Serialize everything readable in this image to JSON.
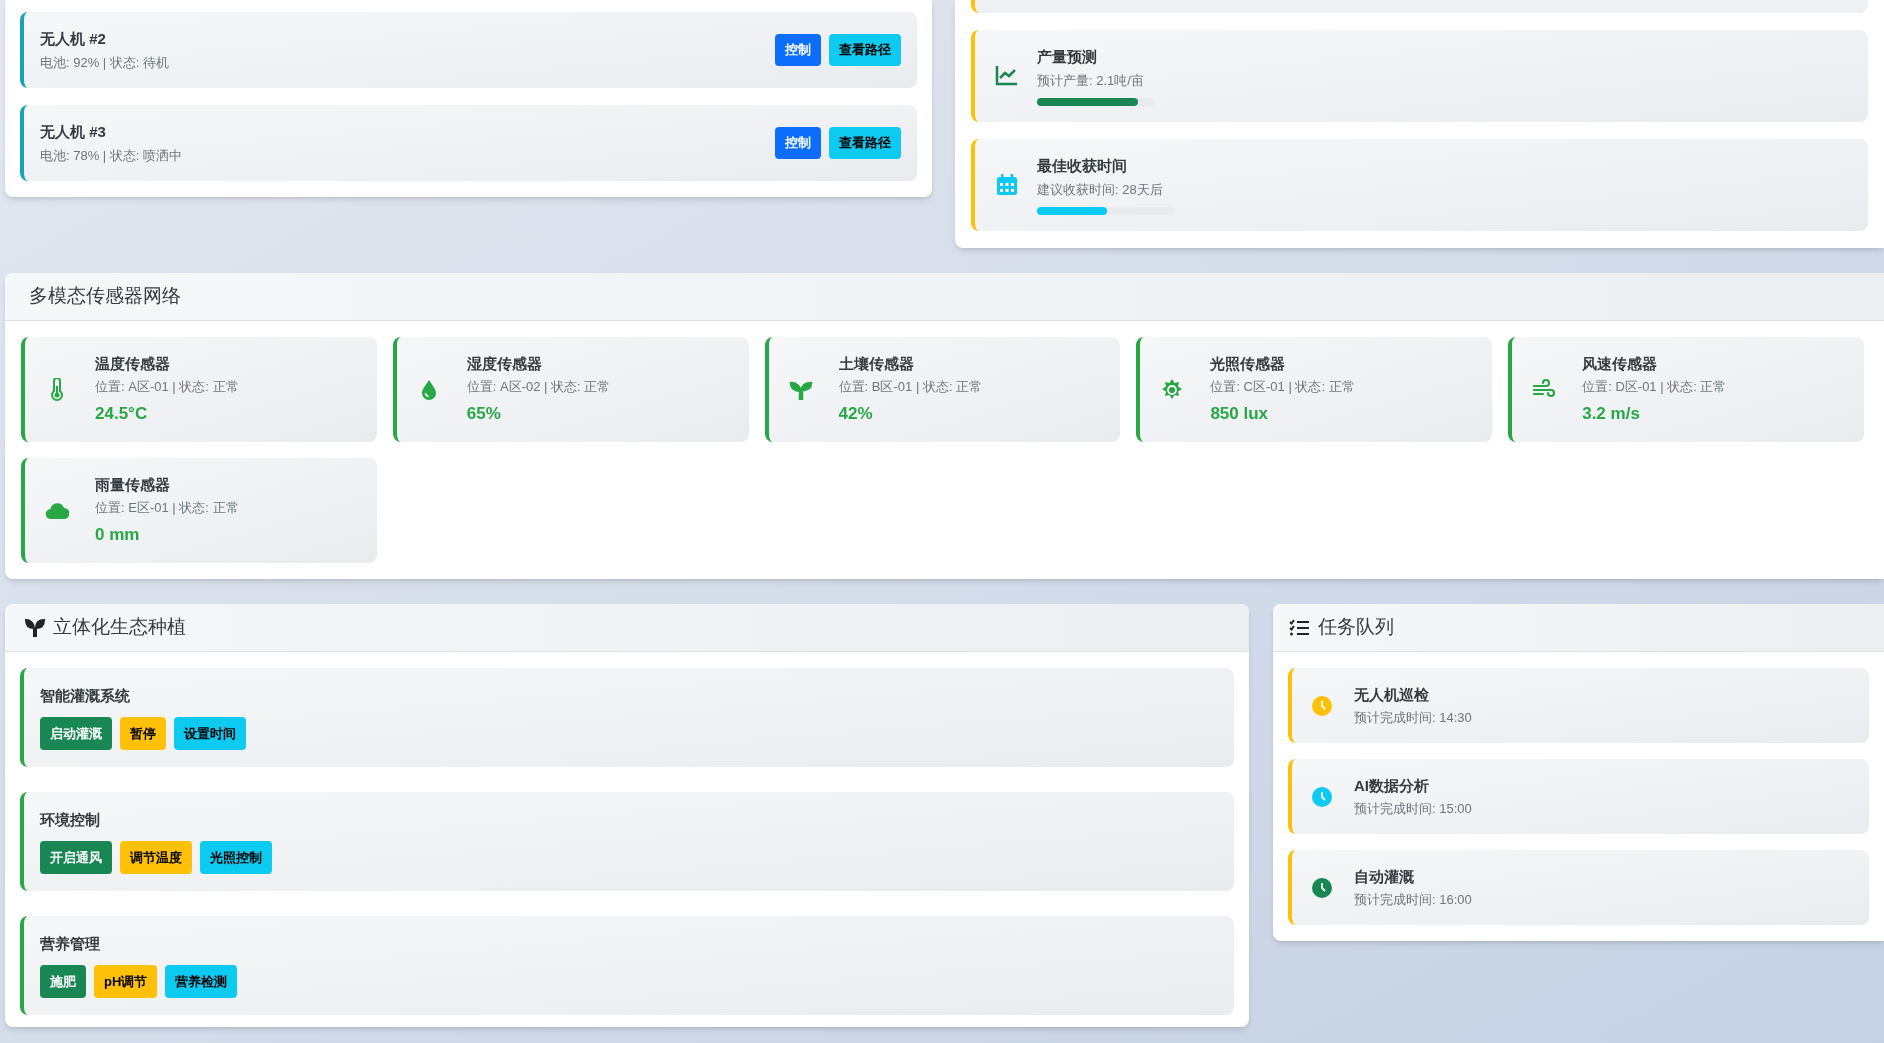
{
  "drones": [
    {
      "name": "无人机 #2",
      "info": "电池: 92% | 状态: 待机",
      "buttons": [
        {
          "label": "控制",
          "kind": "primary"
        },
        {
          "label": "查看路径",
          "kind": "info"
        }
      ]
    },
    {
      "name": "无人机 #3",
      "info": "电池: 78% | 状态: 喷洒中",
      "buttons": [
        {
          "label": "控制",
          "kind": "primary"
        },
        {
          "label": "查看路径",
          "kind": "info"
        }
      ]
    }
  ],
  "predictions": [
    {
      "kind": "yield",
      "title": "产量预测",
      "text": "预计产量: 2.1吨/亩",
      "level": 0.86,
      "color": "#198754"
    },
    {
      "kind": "harvest",
      "title": "最佳收获时间",
      "text": "建议收获时间: 28天后",
      "level": 0.51,
      "color": "#0dcaf0"
    }
  ],
  "sensor_panel": {
    "title": "多模态传感器网络",
    "sensors": [
      {
        "kind": "temperature",
        "name": "温度传感器",
        "info": "位置: A区-01 | 状态: 正常",
        "value": "24.5°C"
      },
      {
        "kind": "humidity",
        "name": "湿度传感器",
        "info": "位置: A区-02 | 状态: 正常",
        "value": "65%"
      },
      {
        "kind": "soil",
        "name": "土壤传感器",
        "info": "位置: B区-01 | 状态: 正常",
        "value": "42%"
      },
      {
        "kind": "light",
        "name": "光照传感器",
        "info": "位置: C区-01 | 状态: 正常",
        "value": "850 lux"
      },
      {
        "kind": "wind",
        "name": "风速传感器",
        "info": "位置: D区-01 | 状态: 正常",
        "value": "3.2 m/s"
      },
      {
        "kind": "rain",
        "name": "雨量传感器",
        "info": "位置: E区-01 | 状态: 正常",
        "value": "0 mm"
      }
    ]
  },
  "planting_panel": {
    "title": "立体化生态种植",
    "groups": [
      {
        "title": "智能灌溉系统",
        "buttons": [
          {
            "label": "启动灌溉",
            "kind": "success"
          },
          {
            "label": "暂停",
            "kind": "warning"
          },
          {
            "label": "设置时间",
            "kind": "info"
          }
        ]
      },
      {
        "title": "环境控制",
        "buttons": [
          {
            "label": "开启通风",
            "kind": "success"
          },
          {
            "label": "调节温度",
            "kind": "warning"
          },
          {
            "label": "光照控制",
            "kind": "info"
          }
        ]
      },
      {
        "title": "营养管理",
        "buttons": [
          {
            "label": "施肥",
            "kind": "success"
          },
          {
            "label": "pH调节",
            "kind": "warning"
          },
          {
            "label": "营养检测",
            "kind": "info"
          }
        ]
      }
    ]
  },
  "task_panel": {
    "title": "任务队列",
    "tasks": [
      {
        "name": "无人机巡检",
        "eta": "预计完成时间: 14:30",
        "color": "#ffc107"
      },
      {
        "name": "AI数据分析",
        "eta": "预计完成时间: 15:00",
        "color": "#0dcaf0"
      },
      {
        "name": "自动灌溉",
        "eta": "预计完成时间: 16:00",
        "color": "#198754"
      }
    ]
  }
}
